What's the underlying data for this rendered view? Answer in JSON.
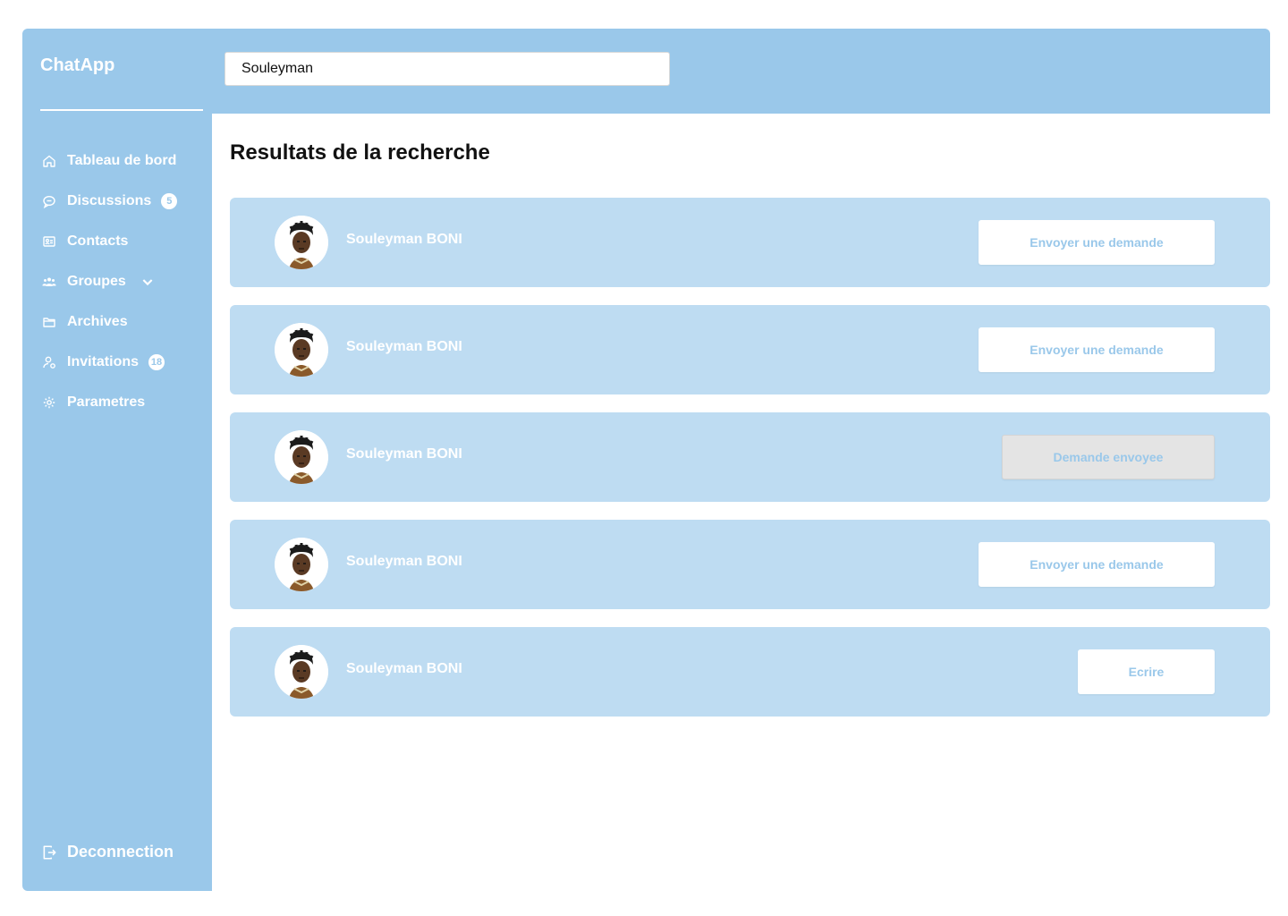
{
  "app": {
    "name": "ChatApp"
  },
  "nav": {
    "items": [
      {
        "label": "Tableau de bord",
        "icon": "home-icon"
      },
      {
        "label": "Discussions",
        "icon": "chat-bubble-icon",
        "badge": "5"
      },
      {
        "label": "Contacts",
        "icon": "contact-card-icon"
      },
      {
        "label": "Groupes",
        "icon": "users-icon",
        "chevron": "chevron-down-icon"
      },
      {
        "label": "Archives",
        "icon": "folder-icon"
      },
      {
        "label": "Invitations",
        "icon": "user-add-icon",
        "badge": "18"
      },
      {
        "label": "Parametres",
        "icon": "gear-icon"
      }
    ],
    "logout": {
      "label": "Deconnection",
      "icon": "logout-icon"
    }
  },
  "search": {
    "value": "Souleyman"
  },
  "main": {
    "title": "Resultats de la recherche"
  },
  "results": [
    {
      "name": "Souleyman BONI",
      "action": "Envoyer une demande",
      "state": "request"
    },
    {
      "name": "Souleyman BONI",
      "action": "Envoyer une demande",
      "state": "request"
    },
    {
      "name": "Souleyman BONI",
      "action": "Demande envoyee",
      "state": "sent"
    },
    {
      "name": "Souleyman BONI",
      "action": "Envoyer une demande",
      "state": "request"
    },
    {
      "name": "Souleyman BONI",
      "action": "Ecrire",
      "state": "friend"
    }
  ],
  "colors": {
    "primary": "#9ac8ea",
    "row_background": "#bedcf2",
    "sent_button": "#e4e4e4"
  }
}
